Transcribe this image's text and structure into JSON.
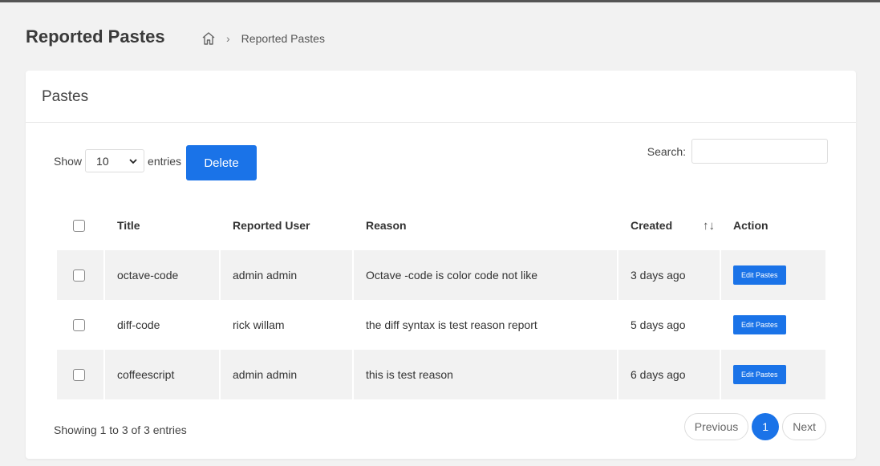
{
  "page": {
    "title": "Reported Pastes"
  },
  "breadcrumb": {
    "home_icon": "home-icon",
    "current": "Reported Pastes"
  },
  "card": {
    "title": "Pastes"
  },
  "controls": {
    "show_label": "Show",
    "entries_label": "entries",
    "page_size": "10",
    "delete_label": "Delete",
    "search_label": "Search:",
    "search_value": ""
  },
  "table": {
    "headers": [
      "",
      "Title",
      "Reported User",
      "Reason",
      "Created",
      "Action"
    ],
    "rows": [
      {
        "title": "octave-code",
        "user": "admin admin",
        "reason": "Octave -code is color code not like",
        "created": "3 days ago",
        "action": "Edit Pastes"
      },
      {
        "title": "diff-code",
        "user": "rick willam",
        "reason": "the diff syntax is test reason report",
        "created": "5 days ago",
        "action": "Edit Pastes"
      },
      {
        "title": "coffeescript",
        "user": "admin admin",
        "reason": "this is test reason",
        "created": "6 days ago",
        "action": "Edit Pastes"
      }
    ]
  },
  "footer": {
    "info": "Showing 1 to 3 of 3 entries",
    "previous": "Previous",
    "current_page": "1",
    "next": "Next"
  },
  "colors": {
    "primary": "#1a73e8",
    "row_stripe": "#f2f2f2"
  }
}
